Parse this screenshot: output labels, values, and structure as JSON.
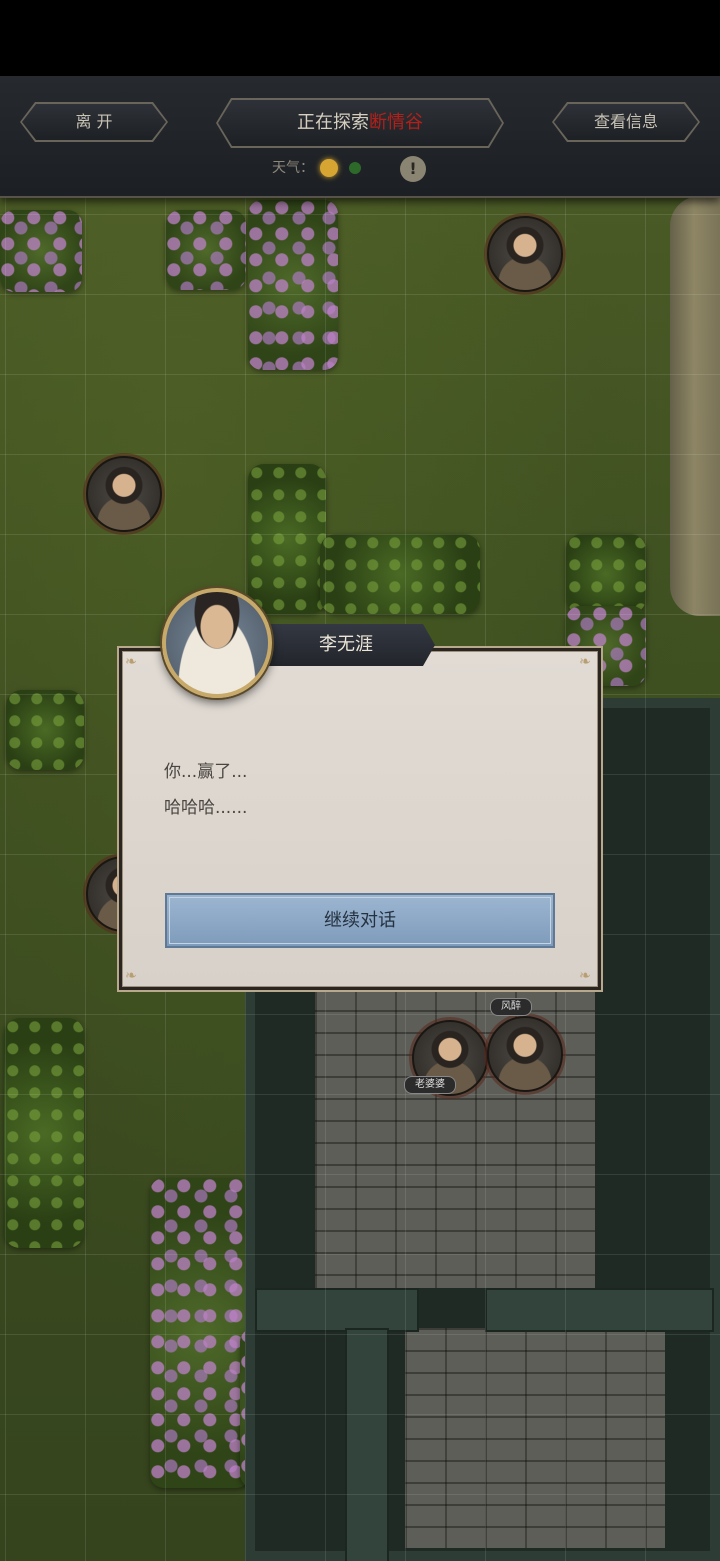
{
  "topbar": {
    "leave_label": "离 开",
    "explore_prefix": "正在探索",
    "explore_location": "断情谷",
    "info_label": "查看信息",
    "weather_label": "天气：",
    "alert_symbol": "!",
    "colors": {
      "location": "#b3201a",
      "sun": "#d7a632"
    }
  },
  "map": {
    "tokens": [
      {
        "name": "npc-token-top",
        "label": ""
      },
      {
        "name": "npc-token-left",
        "label": ""
      },
      {
        "name": "npc-token-laopopo",
        "label": "老婆婆"
      },
      {
        "name": "npc-token-fengzui",
        "label": "风醉"
      }
    ]
  },
  "dialog": {
    "speaker": "李无涯",
    "lines": [
      "你...赢了...",
      "哈哈哈......"
    ],
    "continue_label": "继续对话"
  }
}
